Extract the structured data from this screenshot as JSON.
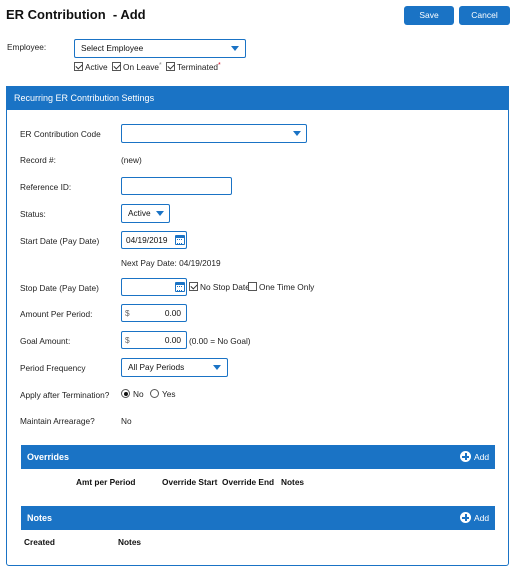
{
  "header": {
    "title": "ER Contribution  - Add",
    "save_label": "Save",
    "cancel_label": "Cancel"
  },
  "employee": {
    "label": "Employee:",
    "select_value": "Select Employee",
    "filters": [
      {
        "label": "Active",
        "checked": true,
        "mark": ""
      },
      {
        "label": "On Leave",
        "checked": true,
        "mark": "*"
      },
      {
        "label": "Terminated",
        "checked": true,
        "mark": "*"
      }
    ]
  },
  "settings": {
    "header": "Recurring ER Contribution Settings",
    "contribution_code": {
      "label": "ER Contribution Code",
      "value": ""
    },
    "record": {
      "label": "Record #:",
      "value": "(new)"
    },
    "reference_id": {
      "label": "Reference ID:",
      "value": ""
    },
    "status": {
      "label": "Status:",
      "value": "Active"
    },
    "start_date": {
      "label": "Start Date (Pay Date)",
      "value": "04/19/2019"
    },
    "next_pay_date": "Next Pay Date: 04/19/2019",
    "stop_date": {
      "label": "Stop Date (Pay Date)",
      "value": "",
      "no_stop_label": "No Stop Date",
      "no_stop_checked": true,
      "one_time_label": "One Time Only",
      "one_time_checked": false
    },
    "amount_per_period": {
      "label": "Amount Per Period:",
      "currency": "$",
      "value": "0.00"
    },
    "goal_amount": {
      "label": "Goal Amount:",
      "currency": "$",
      "value": "0.00",
      "hint": "(0.00 = No Goal)"
    },
    "period_frequency": {
      "label": "Period Frequency",
      "value": "All Pay Periods"
    },
    "apply_after_termination": {
      "label": "Apply after Termination?",
      "options": [
        "No",
        "Yes"
      ],
      "selected": "No"
    },
    "maintain_arrearage": {
      "label": "Maintain Arrearage?",
      "value": "No"
    }
  },
  "overrides": {
    "title": "Overrides",
    "add_label": "Add",
    "columns": [
      "Amt per Period",
      "Override Start",
      "Override End",
      "Notes"
    ]
  },
  "notes": {
    "title": "Notes",
    "add_label": "Add",
    "columns": [
      "Created",
      "Notes"
    ]
  },
  "colors": {
    "accent": "#1a73c5"
  }
}
